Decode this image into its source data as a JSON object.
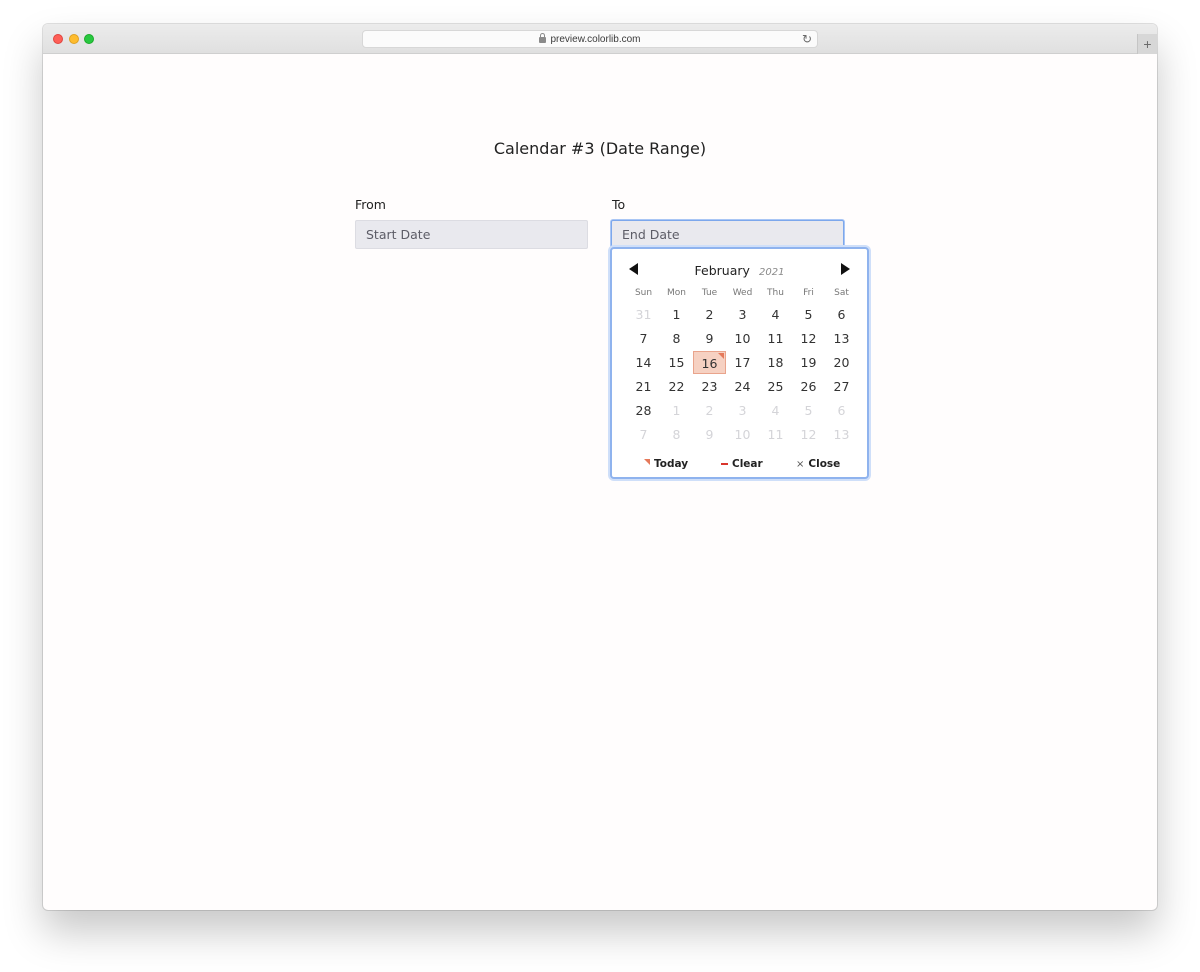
{
  "browser": {
    "url": "preview.colorlib.com",
    "reload_icon": "↻",
    "new_tab_icon": "+"
  },
  "page": {
    "title": "Calendar #3 (Date Range)",
    "from_label": "From",
    "to_label": "To",
    "start_placeholder": "Start Date",
    "end_placeholder": "End Date"
  },
  "datepicker": {
    "month": "February",
    "year": "2021",
    "weekdays": [
      "Sun",
      "Mon",
      "Tue",
      "Wed",
      "Thu",
      "Fri",
      "Sat"
    ],
    "weeks": [
      [
        {
          "d": "31",
          "muted": true
        },
        {
          "d": "1"
        },
        {
          "d": "2"
        },
        {
          "d": "3"
        },
        {
          "d": "4"
        },
        {
          "d": "5"
        },
        {
          "d": "6"
        }
      ],
      [
        {
          "d": "7"
        },
        {
          "d": "8"
        },
        {
          "d": "9"
        },
        {
          "d": "10"
        },
        {
          "d": "11"
        },
        {
          "d": "12"
        },
        {
          "d": "13"
        }
      ],
      [
        {
          "d": "14"
        },
        {
          "d": "15"
        },
        {
          "d": "16",
          "today": true
        },
        {
          "d": "17"
        },
        {
          "d": "18"
        },
        {
          "d": "19"
        },
        {
          "d": "20"
        }
      ],
      [
        {
          "d": "21"
        },
        {
          "d": "22"
        },
        {
          "d": "23"
        },
        {
          "d": "24"
        },
        {
          "d": "25"
        },
        {
          "d": "26"
        },
        {
          "d": "27"
        }
      ],
      [
        {
          "d": "28"
        },
        {
          "d": "1",
          "muted": true
        },
        {
          "d": "2",
          "muted": true
        },
        {
          "d": "3",
          "muted": true
        },
        {
          "d": "4",
          "muted": true
        },
        {
          "d": "5",
          "muted": true
        },
        {
          "d": "6",
          "muted": true
        }
      ],
      [
        {
          "d": "7",
          "muted": true
        },
        {
          "d": "8",
          "muted": true
        },
        {
          "d": "9",
          "muted": true
        },
        {
          "d": "10",
          "muted": true
        },
        {
          "d": "11",
          "muted": true
        },
        {
          "d": "12",
          "muted": true
        },
        {
          "d": "13",
          "muted": true
        }
      ]
    ],
    "today_label": "Today",
    "clear_label": "Clear",
    "close_label": "Close",
    "close_icon_glyph": "×",
    "colors": {
      "today_fill": "#f6d1c2",
      "today_marker": "#e5795a",
      "clear_icon": "#d9352c",
      "focus_border": "#8fb3ee"
    }
  }
}
